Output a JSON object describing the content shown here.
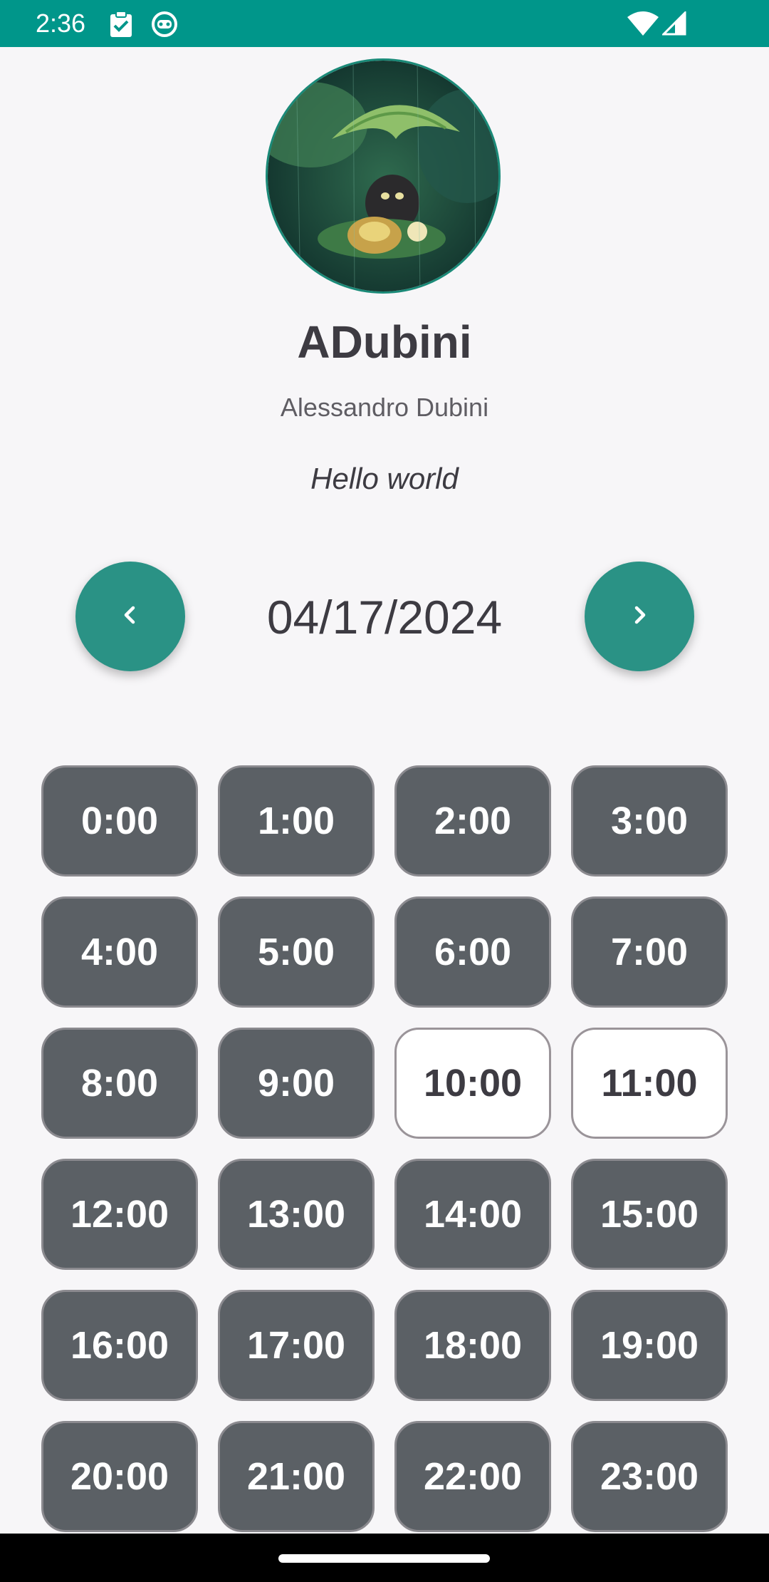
{
  "status_bar": {
    "time": "2:36",
    "icons": [
      "clipboard-check-icon",
      "robot-face-icon",
      "wifi-icon",
      "cellular-signal-icon"
    ],
    "background_color": "#00968a"
  },
  "profile": {
    "avatar_description": "avatar-image",
    "username": "ADubini",
    "full_name": "Alessandro Dubini",
    "bio": "Hello world"
  },
  "date_nav": {
    "date": "04/17/2024",
    "prev_icon": "chevron-left-icon",
    "next_icon": "chevron-right-icon",
    "accent_color": "#2a9285"
  },
  "hours": [
    {
      "label": "0:00",
      "available": false
    },
    {
      "label": "1:00",
      "available": false
    },
    {
      "label": "2:00",
      "available": false
    },
    {
      "label": "3:00",
      "available": false
    },
    {
      "label": "4:00",
      "available": false
    },
    {
      "label": "5:00",
      "available": false
    },
    {
      "label": "6:00",
      "available": false
    },
    {
      "label": "7:00",
      "available": false
    },
    {
      "label": "8:00",
      "available": false
    },
    {
      "label": "9:00",
      "available": false
    },
    {
      "label": "10:00",
      "available": true
    },
    {
      "label": "11:00",
      "available": true
    },
    {
      "label": "12:00",
      "available": false
    },
    {
      "label": "13:00",
      "available": false
    },
    {
      "label": "14:00",
      "available": false
    },
    {
      "label": "15:00",
      "available": false
    },
    {
      "label": "16:00",
      "available": false
    },
    {
      "label": "17:00",
      "available": false
    },
    {
      "label": "18:00",
      "available": false
    },
    {
      "label": "19:00",
      "available": false
    },
    {
      "label": "20:00",
      "available": false
    },
    {
      "label": "21:00",
      "available": false
    },
    {
      "label": "22:00",
      "available": false
    },
    {
      "label": "23:00",
      "available": false
    }
  ],
  "colors": {
    "unavailable_slot": "#5b6065",
    "available_slot": "#ffffff"
  }
}
